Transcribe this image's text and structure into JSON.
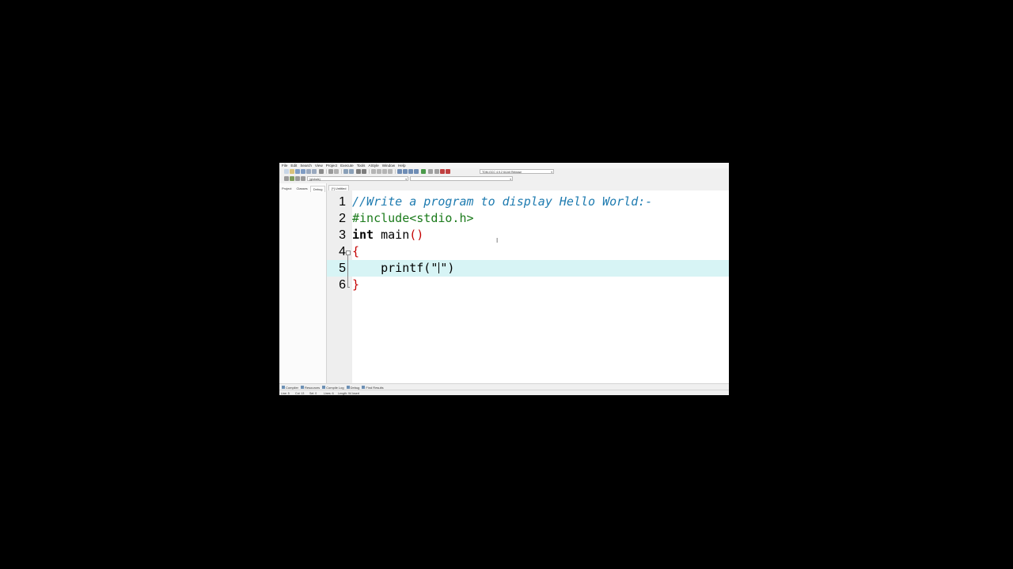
{
  "menu": [
    "File",
    "Edit",
    "Search",
    "View",
    "Project",
    "Execute",
    "Tools",
    "AStyle",
    "Window",
    "Help"
  ],
  "toolbar": {
    "compiler_select": "TDM-GCC 4.9.2 64-bit Release",
    "scope_select": "(globals)"
  },
  "left_panel": {
    "tabs": [
      "Project",
      "Classes",
      "Debug"
    ],
    "active_tab": "Debug"
  },
  "editor": {
    "tab_label": "[*] Untitled",
    "lines": [
      {
        "num": "1",
        "text": "//Write a program to display Hello World:-"
      },
      {
        "num": "2",
        "text": "#include<stdio.h>"
      },
      {
        "num": "3",
        "kw": "int",
        "text": " main",
        "paren": "()"
      },
      {
        "num": "4",
        "brace": "{"
      },
      {
        "num": "5",
        "indent": "    ",
        "text_before": "printf(\"",
        "text_after": "\")",
        "current": true
      },
      {
        "num": "6",
        "brace": "}"
      }
    ]
  },
  "bottom_tabs": [
    "Compiler",
    "Resources",
    "Compile Log",
    "Debug",
    "Find Results"
  ],
  "status": {
    "line": "Line:",
    "line_val": "5",
    "col": "Col:",
    "col_val": "13",
    "sel": "Sel:",
    "sel_val": "0",
    "lines": "Lines:",
    "lines_val": "6",
    "length": "Length:",
    "length_val": "94",
    "mode": "Insert"
  },
  "colors": {
    "current_line": "#d7f4f5",
    "comment": "#1e7bb0",
    "preprocessor": "#1a7a1a",
    "brace": "#c40000"
  }
}
